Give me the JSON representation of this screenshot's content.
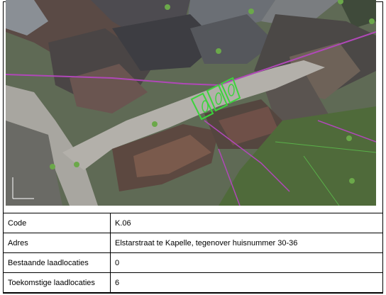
{
  "map": {
    "image": "aerial-photo-elstarstraat",
    "charging_symbols": 3
  },
  "info_table": {
    "rows": [
      {
        "key": "Code",
        "value": "K.06"
      },
      {
        "key": "Adres",
        "value": "Elstarstraat te Kapelle, tegenover huisnummer 30-36"
      },
      {
        "key": "Bestaande laadlocaties",
        "value": "0"
      },
      {
        "key": "Toekomstige laadlocaties",
        "value": "6"
      }
    ]
  }
}
